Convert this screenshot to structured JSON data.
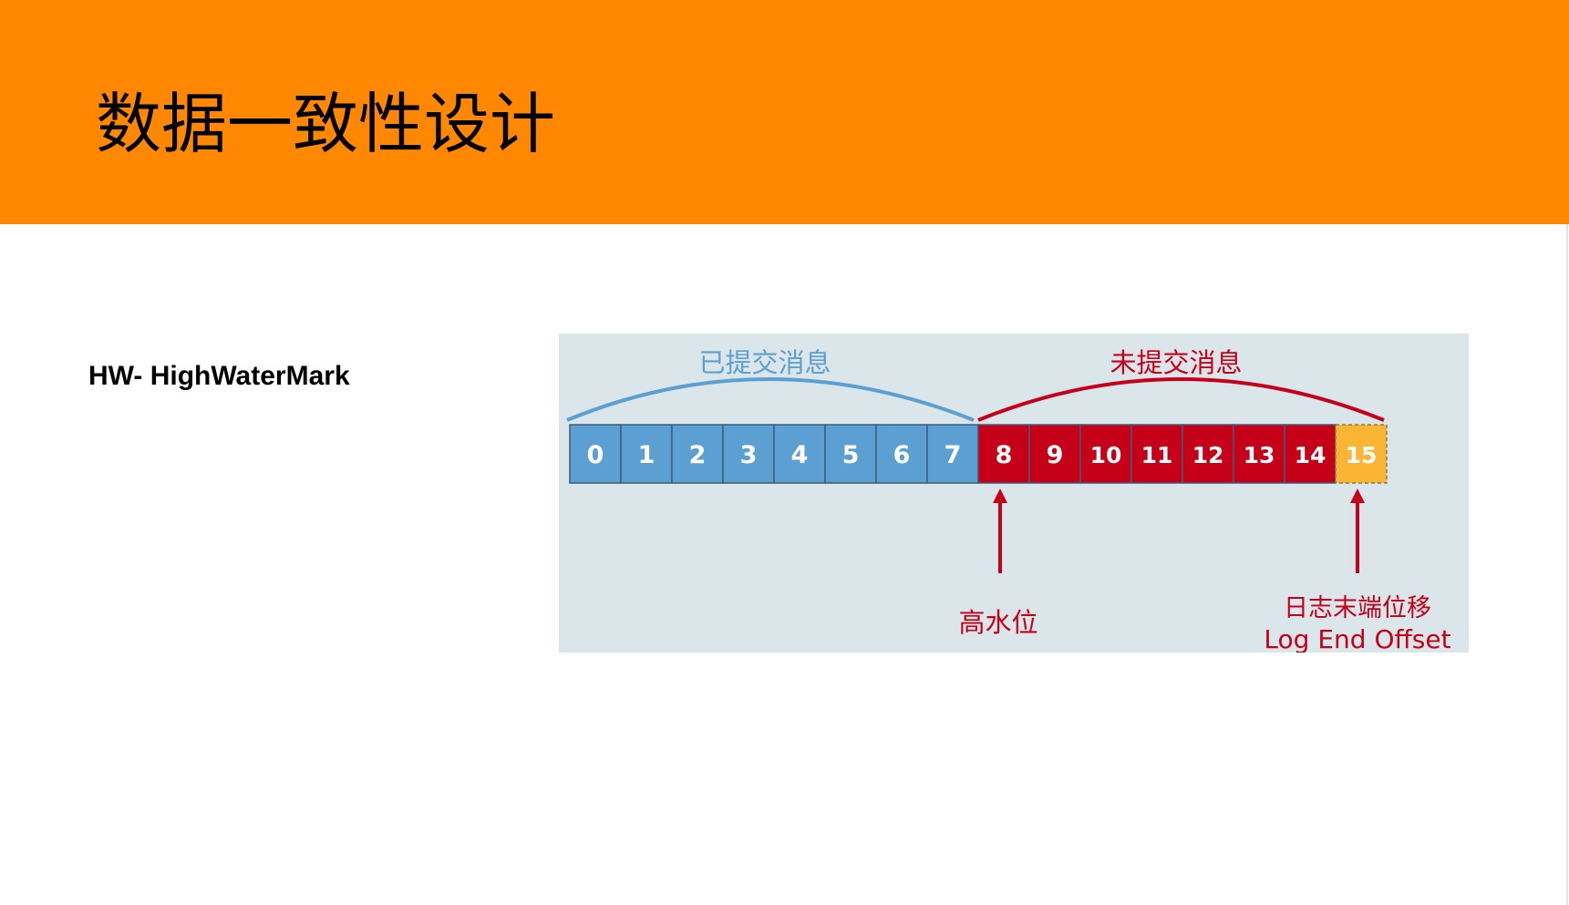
{
  "slide": {
    "title": "数据一致性设计",
    "subtitle": "HW- HighWaterMark"
  },
  "diagram": {
    "offsets": [
      "0",
      "1",
      "2",
      "3",
      "4",
      "5",
      "6",
      "7",
      "8",
      "9",
      "10",
      "11",
      "12",
      "13",
      "14",
      "15"
    ],
    "committed_count": 8,
    "uncommitted_count": 7,
    "committed_label": "已提交消息",
    "uncommitted_label": "未提交消息",
    "high_watermark_label": "高水位",
    "log_end_offset_label_cn": "日志末端位移",
    "log_end_offset_label_en": "Log End Offset",
    "colors": {
      "header": "#ff8800",
      "background": "#dae6e9",
      "committed": "#5b9fd3",
      "uncommitted": "#c60018",
      "leo": "#fbb534",
      "committed_text": "#5b9fd3",
      "uncommitted_text": "#c60018"
    }
  }
}
